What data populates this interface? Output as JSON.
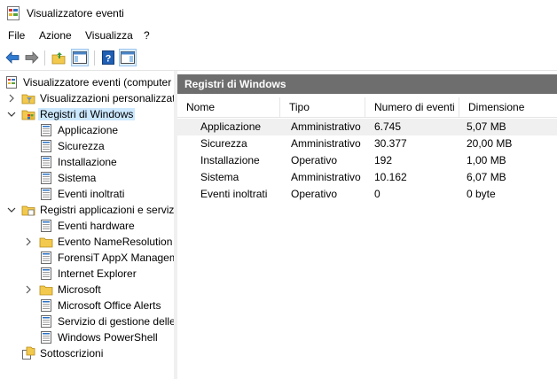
{
  "window": {
    "title": "Visualizzatore eventi"
  },
  "menu": [
    "File",
    "Azione",
    "Visualizza",
    "?"
  ],
  "toolbar": {
    "buttons": [
      {
        "name": "back-arrow-icon"
      },
      {
        "name": "forward-arrow-icon"
      },
      {
        "name": "up-folder-icon"
      },
      {
        "name": "show-hide-console-tree-icon"
      },
      {
        "name": "help-icon"
      },
      {
        "name": "show-hide-action-pane-icon"
      }
    ]
  },
  "tree": {
    "root": "Visualizzatore eventi (computer",
    "custom_views": "Visualizzazioni personalizzate",
    "windows_logs": "Registri di Windows",
    "windows_logs_children": [
      "Applicazione",
      "Sicurezza",
      "Installazione",
      "Sistema",
      "Eventi inoltrati"
    ],
    "app_services": "Registri applicazioni e servizi",
    "app_services_children": [
      {
        "label": "Eventi hardware",
        "type": "log",
        "expandable": false
      },
      {
        "label": "Evento NameResolution",
        "type": "folder",
        "expandable": true
      },
      {
        "label": "ForensiT AppX Managem",
        "type": "log",
        "expandable": false
      },
      {
        "label": "Internet Explorer",
        "type": "log",
        "expandable": false
      },
      {
        "label": "Microsoft",
        "type": "folder",
        "expandable": true
      },
      {
        "label": "Microsoft Office Alerts",
        "type": "log",
        "expandable": false
      },
      {
        "label": "Servizio di gestione delle",
        "type": "log",
        "expandable": false
      },
      {
        "label": "Windows PowerShell",
        "type": "log",
        "expandable": false
      }
    ],
    "subscriptions": "Sottoscrizioni"
  },
  "main": {
    "header": "Registri di Windows",
    "columns": [
      "Nome",
      "Tipo",
      "Numero di eventi",
      "Dimensione"
    ],
    "rows": [
      [
        "Applicazione",
        "Amministrativo",
        "6.745",
        "5,07 MB"
      ],
      [
        "Sicurezza",
        "Amministrativo",
        "30.377",
        "20,00 MB"
      ],
      [
        "Installazione",
        "Operativo",
        "192",
        "1,00 MB"
      ],
      [
        "Sistema",
        "Amministrativo",
        "10.162",
        "6,07 MB"
      ],
      [
        "Eventi inoltrati",
        "Operativo",
        "0",
        "0 byte"
      ]
    ]
  },
  "colors": {
    "selection": "#cce8ff",
    "pane_header": "#6e6e6e",
    "accent": "#1e63b8"
  }
}
